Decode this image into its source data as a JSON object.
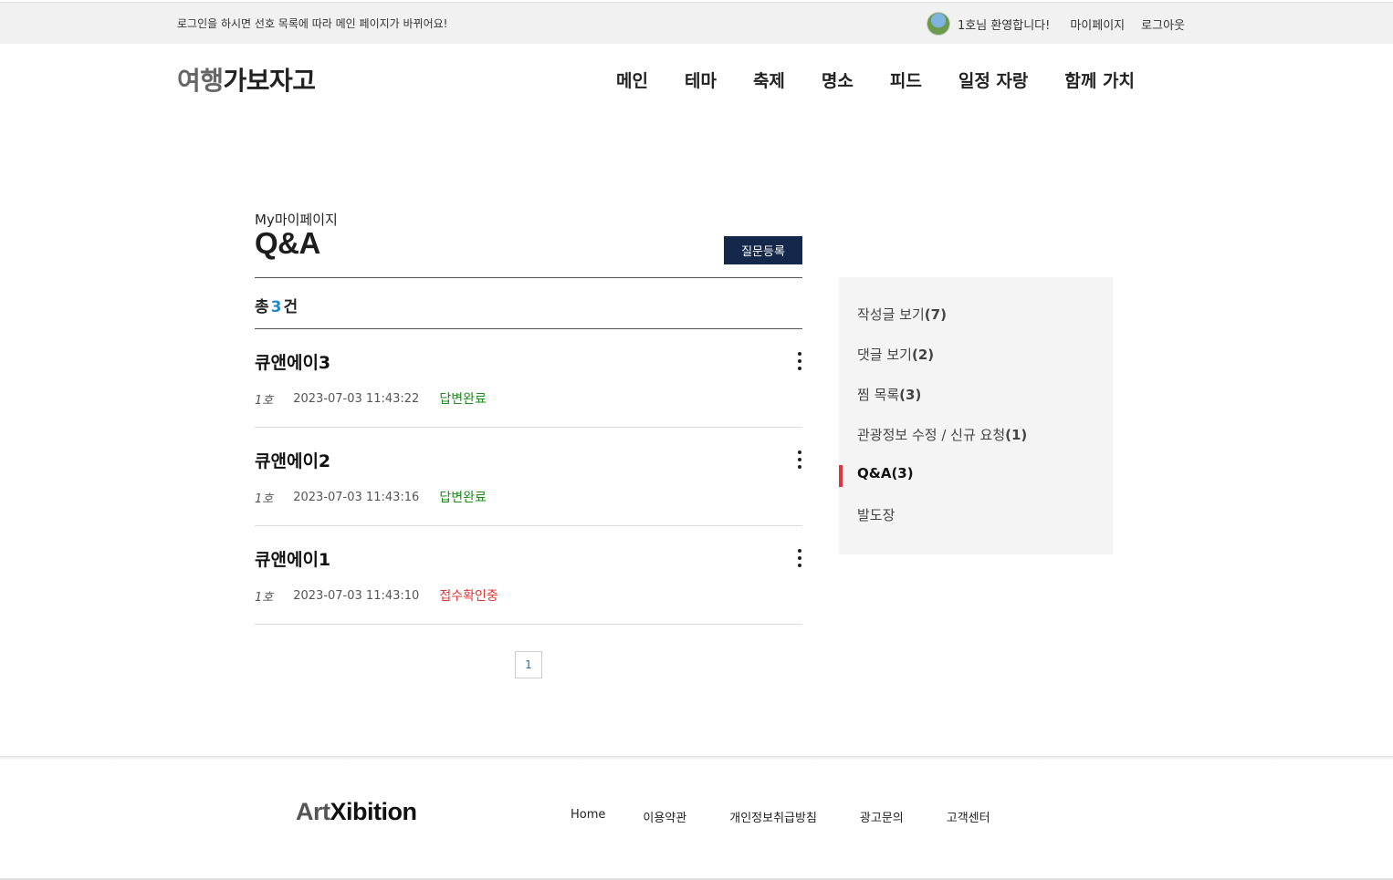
{
  "topbar": {
    "notice": "로그인을 하시면 선호 목록에 따라 메인 페이지가 바뀌어요!",
    "welcome": "1호님 환영합니다!",
    "mypage": "마이페이지",
    "logout": "로그아웃"
  },
  "header": {
    "logo_part1": "여행",
    "logo_part2": "가보자고",
    "nav": [
      "메인",
      "테마",
      "축제",
      "명소",
      "피드",
      "일정 자랑",
      "함께 가치"
    ]
  },
  "page": {
    "subtitle": "My마이페이지",
    "title": "Q&A",
    "ask_button": "질문등록",
    "count_prefix": "총",
    "count": "3",
    "count_suffix": "건"
  },
  "questions": [
    {
      "title": "큐앤에이3",
      "author": "1호",
      "date": "2023-07-03 11:43:22",
      "status": "답변완료",
      "status_color": "#1e8a1e"
    },
    {
      "title": "큐앤에이2",
      "author": "1호",
      "date": "2023-07-03 11:43:16",
      "status": "답변완료",
      "status_color": "#1e8a1e"
    },
    {
      "title": "큐앤에이1",
      "author": "1호",
      "date": "2023-07-03 11:43:10",
      "status": "접수확인중",
      "status_color": "#e03434"
    }
  ],
  "pagination": {
    "current": "1"
  },
  "side_menu": [
    {
      "label": "작성글 보기",
      "count": "(7)"
    },
    {
      "label": "댓글 보기",
      "count": "(2)"
    },
    {
      "label": "찜 목록",
      "count": "(3)"
    },
    {
      "label": "관광정보 수정 / 신규 요청",
      "count": "(1)"
    },
    {
      "label": "Q&A",
      "count": "(3)",
      "active": true
    },
    {
      "label": "발도장",
      "count": ""
    }
  ],
  "footer": {
    "logo_part1": "Art",
    "logo_part2": "Xibition",
    "links": [
      "Home",
      "이용약관",
      "개인정보취급방침",
      "광고문의",
      "고객센터"
    ]
  },
  "colors": {
    "accent_navy": "#14284b",
    "count_blue": "#2089c9",
    "active_bar": "#e0363d"
  }
}
